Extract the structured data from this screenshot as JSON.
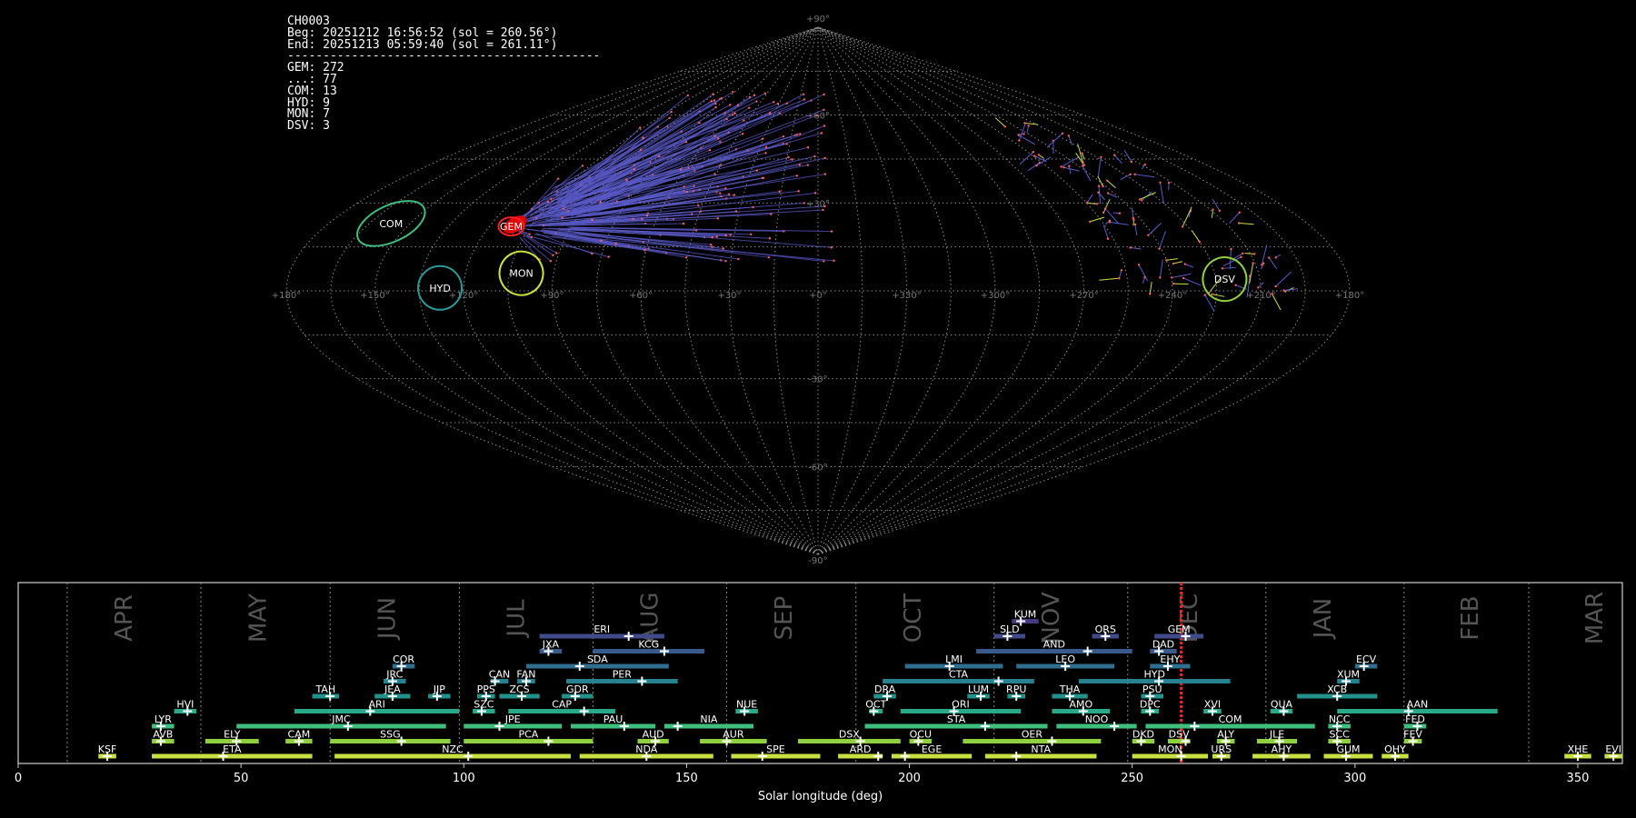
{
  "info": {
    "id": "CH0003",
    "beg": "Beg: 20251212 16:56:52 (sol = 260.56°)",
    "end": "End: 20251213 05:59:40 (sol = 261.11°)",
    "sep": "--------------------------------------------",
    "counts": [
      "GEM: 272",
      "...: 77",
      "COM: 13",
      "HYD: 9",
      "MON: 7",
      "DSV: 3"
    ]
  },
  "chart_data": [
    {
      "type": "scatter",
      "projection": "sinusoidal",
      "grid": true,
      "lon_labels": [
        "+180°",
        "+150°",
        "+120°",
        "+90°",
        "+60°",
        "+30°",
        "+0°",
        "+330°",
        "+300°",
        "+270°",
        "+240°",
        "+210°",
        "+180°"
      ],
      "lon_values": [
        180,
        150,
        120,
        90,
        60,
        30,
        0,
        330,
        300,
        270,
        240,
        210,
        180
      ],
      "lat_labels": [
        "+90°",
        "+60°",
        "+30°",
        "-30°",
        "-60°",
        "-90°"
      ],
      "lat_values": [
        90,
        60,
        30,
        -30,
        -60,
        -90
      ],
      "radiants": [
        {
          "name": "COM",
          "lon": 157,
          "lat": 23,
          "color": "#3fbf7f",
          "rx": 40,
          "ry": 20
        },
        {
          "name": "GEM",
          "lon": 112,
          "lat": 22,
          "color": "#ff2020",
          "rx": 14,
          "ry": 10
        },
        {
          "name": "MON",
          "lon": 101,
          "lat": 6,
          "color": "#c8e040",
          "rx": 24,
          "ry": 24
        },
        {
          "name": "HYD",
          "lon": 128,
          "lat": 1,
          "color": "#2a9a9a",
          "rx": 24,
          "ry": 24
        },
        {
          "name": "DSV",
          "lon": 222,
          "lat": 4,
          "color": "#8ed040",
          "rx": 24,
          "ry": 24
        }
      ]
    },
    {
      "type": "bar",
      "orientation": "horizontal-ranges",
      "xlabel": "Solar longitude (deg)",
      "xlim": [
        0,
        360
      ],
      "xticks": [
        0,
        50,
        100,
        150,
        200,
        250,
        300,
        350
      ],
      "current_sol": 261,
      "months": [
        {
          "name": "APR",
          "at": 24
        },
        {
          "name": "MAY",
          "at": 54
        },
        {
          "name": "JUN",
          "at": 83
        },
        {
          "name": "JUL",
          "at": 112
        },
        {
          "name": "AUG",
          "at": 142
        },
        {
          "name": "SEP",
          "at": 172
        },
        {
          "name": "OCT",
          "at": 201
        },
        {
          "name": "NOV",
          "at": 232
        },
        {
          "name": "DEC",
          "at": 263
        },
        {
          "name": "JAN",
          "at": 293
        },
        {
          "name": "FEB",
          "at": 326
        },
        {
          "name": "MAR",
          "at": 354
        }
      ],
      "month_bounds": [
        11,
        41,
        70,
        99,
        129,
        159,
        188,
        219,
        249,
        280,
        311,
        339
      ],
      "showers": [
        {
          "code": "KSF",
          "start": 18,
          "end": 22,
          "peak": 20,
          "row": 0,
          "color": "#c8e040"
        },
        {
          "code": "ETA",
          "start": 30,
          "end": 66,
          "peak": 46,
          "row": 0,
          "color": "#c8e040"
        },
        {
          "code": "NZC",
          "start": 71,
          "end": 124,
          "peak": 101,
          "row": 0,
          "color": "#c8e040"
        },
        {
          "code": "NDA",
          "start": 126,
          "end": 156,
          "peak": 141,
          "row": 0,
          "color": "#c8e040"
        },
        {
          "code": "SPE",
          "start": 160,
          "end": 180,
          "peak": 167,
          "row": 0,
          "color": "#c8e040"
        },
        {
          "code": "ARD",
          "start": 184,
          "end": 194,
          "peak": 193,
          "row": 0,
          "color": "#c8e040"
        },
        {
          "code": "EGE",
          "start": 196,
          "end": 214,
          "peak": 199,
          "row": 0,
          "color": "#c8e040"
        },
        {
          "code": "NTA",
          "start": 217,
          "end": 242,
          "peak": 224,
          "row": 0,
          "color": "#c8e040"
        },
        {
          "code": "MON",
          "start": 250,
          "end": 267,
          "peak": 261,
          "row": 0,
          "color": "#c8e040"
        },
        {
          "code": "URS",
          "start": 268,
          "end": 272,
          "peak": 270,
          "row": 0,
          "color": "#c8e040"
        },
        {
          "code": "AHY",
          "start": 277,
          "end": 290,
          "peak": 284,
          "row": 0,
          "color": "#c8e040"
        },
        {
          "code": "GUM",
          "start": 293,
          "end": 304,
          "peak": 298,
          "row": 0,
          "color": "#c8e040"
        },
        {
          "code": "OHY",
          "start": 306,
          "end": 312,
          "peak": 309,
          "row": 0,
          "color": "#c8e040"
        },
        {
          "code": "XHE",
          "start": 347,
          "end": 353,
          "peak": 350,
          "row": 0,
          "color": "#c8e040"
        },
        {
          "code": "EVI",
          "start": 356,
          "end": 360,
          "peak": 358,
          "row": 0,
          "color": "#c8e040"
        },
        {
          "code": "AVB",
          "start": 30,
          "end": 35,
          "peak": 32,
          "row": 1,
          "color": "#8ed040"
        },
        {
          "code": "ELY",
          "start": 42,
          "end": 54,
          "peak": 49,
          "row": 1,
          "color": "#8ed040"
        },
        {
          "code": "CAM",
          "start": 60,
          "end": 66,
          "peak": 63,
          "row": 1,
          "color": "#8ed040"
        },
        {
          "code": "SSG",
          "start": 70,
          "end": 97,
          "peak": 86,
          "row": 1,
          "color": "#8ed040"
        },
        {
          "code": "PCA",
          "start": 100,
          "end": 129,
          "peak": 119,
          "row": 1,
          "color": "#8ed040"
        },
        {
          "code": "AUD",
          "start": 139,
          "end": 146,
          "peak": 143,
          "row": 1,
          "color": "#8ed040"
        },
        {
          "code": "AUR",
          "start": 153,
          "end": 168,
          "peak": 159,
          "row": 1,
          "color": "#8ed040"
        },
        {
          "code": "DSX",
          "start": 175,
          "end": 198,
          "peak": 189,
          "row": 1,
          "color": "#8ed040"
        },
        {
          "code": "OCU",
          "start": 200,
          "end": 205,
          "peak": 202,
          "row": 1,
          "color": "#8ed040"
        },
        {
          "code": "OER",
          "start": 212,
          "end": 243,
          "peak": 232,
          "row": 1,
          "color": "#8ed040"
        },
        {
          "code": "DKD",
          "start": 250,
          "end": 255,
          "peak": 252,
          "row": 1,
          "color": "#8ed040"
        },
        {
          "code": "DSV",
          "start": 258,
          "end": 263,
          "peak": 262,
          "row": 1,
          "color": "#8ed040"
        },
        {
          "code": "ALY",
          "start": 269,
          "end": 273,
          "peak": 271,
          "row": 1,
          "color": "#8ed040"
        },
        {
          "code": "JLE",
          "start": 278,
          "end": 287,
          "peak": 283,
          "row": 1,
          "color": "#8ed040"
        },
        {
          "code": "SCC",
          "start": 294,
          "end": 299,
          "peak": 296,
          "row": 1,
          "color": "#8ed040"
        },
        {
          "code": "FEV",
          "start": 311,
          "end": 315,
          "peak": 313,
          "row": 1,
          "color": "#8ed040"
        },
        {
          "code": "LYR",
          "start": 30,
          "end": 35,
          "peak": 32,
          "row": 2,
          "color": "#3fbf7f"
        },
        {
          "code": "JMC",
          "start": 49,
          "end": 96,
          "peak": 74,
          "row": 2,
          "color": "#3fbf7f"
        },
        {
          "code": "JPE",
          "start": 100,
          "end": 122,
          "peak": 108,
          "row": 2,
          "color": "#3fbf7f"
        },
        {
          "code": "PAU",
          "start": 124,
          "end": 143,
          "peak": 136,
          "row": 2,
          "color": "#3fbf7f"
        },
        {
          "code": "NIA",
          "start": 145,
          "end": 165,
          "peak": 148,
          "row": 2,
          "color": "#3fbf7f"
        },
        {
          "code": "STA",
          "start": 190,
          "end": 231,
          "peak": 217,
          "row": 2,
          "color": "#3fbf7f"
        },
        {
          "code": "NOO",
          "start": 233,
          "end": 251,
          "peak": 246,
          "row": 2,
          "color": "#3fbf7f"
        },
        {
          "code": "COM",
          "start": 253,
          "end": 291,
          "peak": 264,
          "row": 2,
          "color": "#3fbf7f"
        },
        {
          "code": "NCC",
          "start": 294,
          "end": 299,
          "peak": 296,
          "row": 2,
          "color": "#3fbf7f"
        },
        {
          "code": "FED",
          "start": 311,
          "end": 316,
          "peak": 314,
          "row": 2,
          "color": "#3fbf7f"
        },
        {
          "code": "HVI",
          "start": 35,
          "end": 40,
          "peak": 38,
          "row": 3,
          "color": "#2aa88a"
        },
        {
          "code": "ARI",
          "start": 62,
          "end": 99,
          "peak": 79,
          "row": 3,
          "color": "#2aa88a"
        },
        {
          "code": "SZC",
          "start": 102,
          "end": 107,
          "peak": 104,
          "row": 3,
          "color": "#2aa88a"
        },
        {
          "code": "CAP",
          "start": 110,
          "end": 134,
          "peak": 127,
          "row": 3,
          "color": "#2aa88a"
        },
        {
          "code": "NUE",
          "start": 161,
          "end": 166,
          "peak": 163,
          "row": 3,
          "color": "#2aa88a"
        },
        {
          "code": "OCT",
          "start": 191,
          "end": 194,
          "peak": 192,
          "row": 3,
          "color": "#2aa88a"
        },
        {
          "code": "ORI",
          "start": 198,
          "end": 225,
          "peak": 210,
          "row": 3,
          "color": "#2aa88a"
        },
        {
          "code": "AMO",
          "start": 232,
          "end": 245,
          "peak": 239,
          "row": 3,
          "color": "#2aa88a"
        },
        {
          "code": "DPC",
          "start": 252,
          "end": 256,
          "peak": 254,
          "row": 3,
          "color": "#2aa88a"
        },
        {
          "code": "XVI",
          "start": 266,
          "end": 270,
          "peak": 268,
          "row": 3,
          "color": "#2aa88a"
        },
        {
          "code": "QUA",
          "start": 281,
          "end": 286,
          "peak": 284,
          "row": 3,
          "color": "#2aa88a"
        },
        {
          "code": "AAN",
          "start": 296,
          "end": 332,
          "peak": 312,
          "row": 3,
          "color": "#2aa88a"
        },
        {
          "code": "TAH",
          "start": 66,
          "end": 72,
          "peak": 70,
          "row": 4,
          "color": "#23928c"
        },
        {
          "code": "JEA",
          "start": 80,
          "end": 88,
          "peak": 84,
          "row": 4,
          "color": "#23928c"
        },
        {
          "code": "JIP",
          "start": 92,
          "end": 97,
          "peak": 94,
          "row": 4,
          "color": "#23928c"
        },
        {
          "code": "PPS",
          "start": 103,
          "end": 107,
          "peak": 105,
          "row": 4,
          "color": "#23928c"
        },
        {
          "code": "ZCS",
          "start": 108,
          "end": 117,
          "peak": 113,
          "row": 4,
          "color": "#23928c"
        },
        {
          "code": "GDR",
          "start": 122,
          "end": 129,
          "peak": 125,
          "row": 4,
          "color": "#23928c"
        },
        {
          "code": "DRA",
          "start": 192,
          "end": 197,
          "peak": 195,
          "row": 4,
          "color": "#23928c"
        },
        {
          "code": "LUM",
          "start": 213,
          "end": 218,
          "peak": 216,
          "row": 4,
          "color": "#23928c"
        },
        {
          "code": "RPU",
          "start": 222,
          "end": 226,
          "peak": 224,
          "row": 4,
          "color": "#23928c"
        },
        {
          "code": "THA",
          "start": 232,
          "end": 240,
          "peak": 236,
          "row": 4,
          "color": "#23928c"
        },
        {
          "code": "PSU",
          "start": 252,
          "end": 257,
          "peak": 254,
          "row": 4,
          "color": "#23928c"
        },
        {
          "code": "XCB",
          "start": 287,
          "end": 305,
          "peak": 296,
          "row": 4,
          "color": "#23928c"
        },
        {
          "code": "JRC",
          "start": 82,
          "end": 87,
          "peak": 84,
          "row": 5,
          "color": "#26828e"
        },
        {
          "code": "CAN",
          "start": 106,
          "end": 110,
          "peak": 107,
          "row": 5,
          "color": "#26828e"
        },
        {
          "code": "FAN",
          "start": 112,
          "end": 116,
          "peak": 114,
          "row": 5,
          "color": "#26828e"
        },
        {
          "code": "PER",
          "start": 123,
          "end": 148,
          "peak": 140,
          "row": 5,
          "color": "#26828e"
        },
        {
          "code": "CTA",
          "start": 194,
          "end": 228,
          "peak": 220,
          "row": 5,
          "color": "#26828e"
        },
        {
          "code": "HYD",
          "start": 238,
          "end": 272,
          "peak": 256,
          "row": 5,
          "color": "#26828e"
        },
        {
          "code": "XUM",
          "start": 296,
          "end": 301,
          "peak": 298,
          "row": 5,
          "color": "#26828e"
        },
        {
          "code": "COR",
          "start": 84,
          "end": 89,
          "peak": 86,
          "row": 6,
          "color": "#2f6e8e"
        },
        {
          "code": "SDA",
          "start": 114,
          "end": 146,
          "peak": 126,
          "row": 6,
          "color": "#2f6e8e"
        },
        {
          "code": "LMI",
          "start": 199,
          "end": 221,
          "peak": 209,
          "row": 6,
          "color": "#2f6e8e"
        },
        {
          "code": "LEO",
          "start": 224,
          "end": 246,
          "peak": 235,
          "row": 6,
          "color": "#2f6e8e"
        },
        {
          "code": "EHY",
          "start": 254,
          "end": 263,
          "peak": 258,
          "row": 6,
          "color": "#2f6e8e"
        },
        {
          "code": "ECV",
          "start": 300,
          "end": 305,
          "peak": 302,
          "row": 6,
          "color": "#2f6e8e"
        },
        {
          "code": "JXA",
          "start": 117,
          "end": 122,
          "peak": 119,
          "row": 7,
          "color": "#3b5a8c"
        },
        {
          "code": "KCG",
          "start": 129,
          "end": 154,
          "peak": 145,
          "row": 7,
          "color": "#3b5a8c"
        },
        {
          "code": "AND",
          "start": 215,
          "end": 250,
          "peak": 240,
          "row": 7,
          "color": "#3b5a8c"
        },
        {
          "code": "DAD",
          "start": 254,
          "end": 260,
          "peak": 256,
          "row": 7,
          "color": "#3b5a8c"
        },
        {
          "code": "ERI",
          "start": 117,
          "end": 145,
          "peak": 137,
          "row": 8,
          "color": "#414b8a"
        },
        {
          "code": "SLD",
          "start": 219,
          "end": 226,
          "peak": 222,
          "row": 8,
          "color": "#414b8a"
        },
        {
          "code": "ORS",
          "start": 241,
          "end": 247,
          "peak": 244,
          "row": 8,
          "color": "#414b8a"
        },
        {
          "code": "GEM",
          "start": 255,
          "end": 266,
          "peak": 262,
          "row": 8,
          "color": "#414b8a"
        },
        {
          "code": "KUM",
          "start": 223,
          "end": 229,
          "peak": 225,
          "row": 9,
          "color": "#463a82"
        }
      ]
    }
  ]
}
